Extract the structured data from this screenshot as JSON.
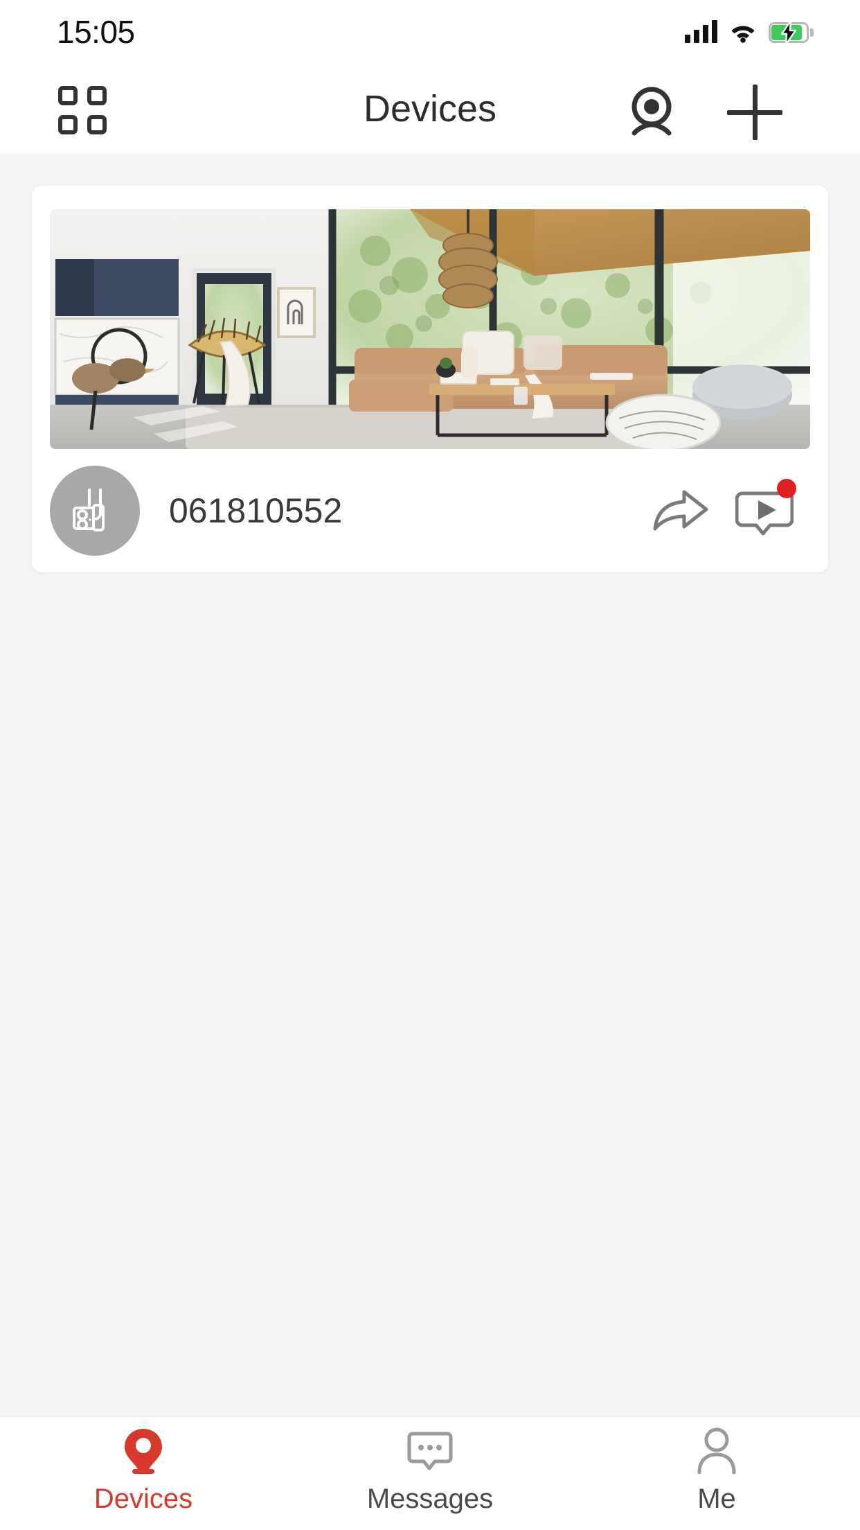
{
  "status_bar": {
    "time": "15:05",
    "signal_icon": "cellular-signal-icon",
    "signal_bars": 4,
    "wifi_icon": "wifi-icon",
    "battery_icon": "battery-charging-icon",
    "battery_color": "#3ecb5b",
    "battery_charging": true
  },
  "header": {
    "title": "Devices",
    "grid_icon": "grid-view-icon",
    "camera_icon": "webcam-icon",
    "add_icon": "plus-icon"
  },
  "devices": [
    {
      "name": "061810552",
      "avatar_icon": "security-camera-icon",
      "avatar_bg": "#a8a8a8",
      "share_icon": "share-arrow-icon",
      "playback_icon": "video-message-icon",
      "has_unread_badge": true,
      "badge_color": "#e02020",
      "thumbnail_alt": "living-room-snapshot"
    }
  ],
  "tab_bar": {
    "active_color": "#d7392c",
    "inactive_color": "#9a9a9a",
    "tabs": [
      {
        "label": "Devices",
        "icon": "camera-dome-icon",
        "active": true
      },
      {
        "label": "Messages",
        "icon": "chat-bubble-icon",
        "active": false
      },
      {
        "label": "Me",
        "icon": "person-icon",
        "active": false
      }
    ]
  }
}
